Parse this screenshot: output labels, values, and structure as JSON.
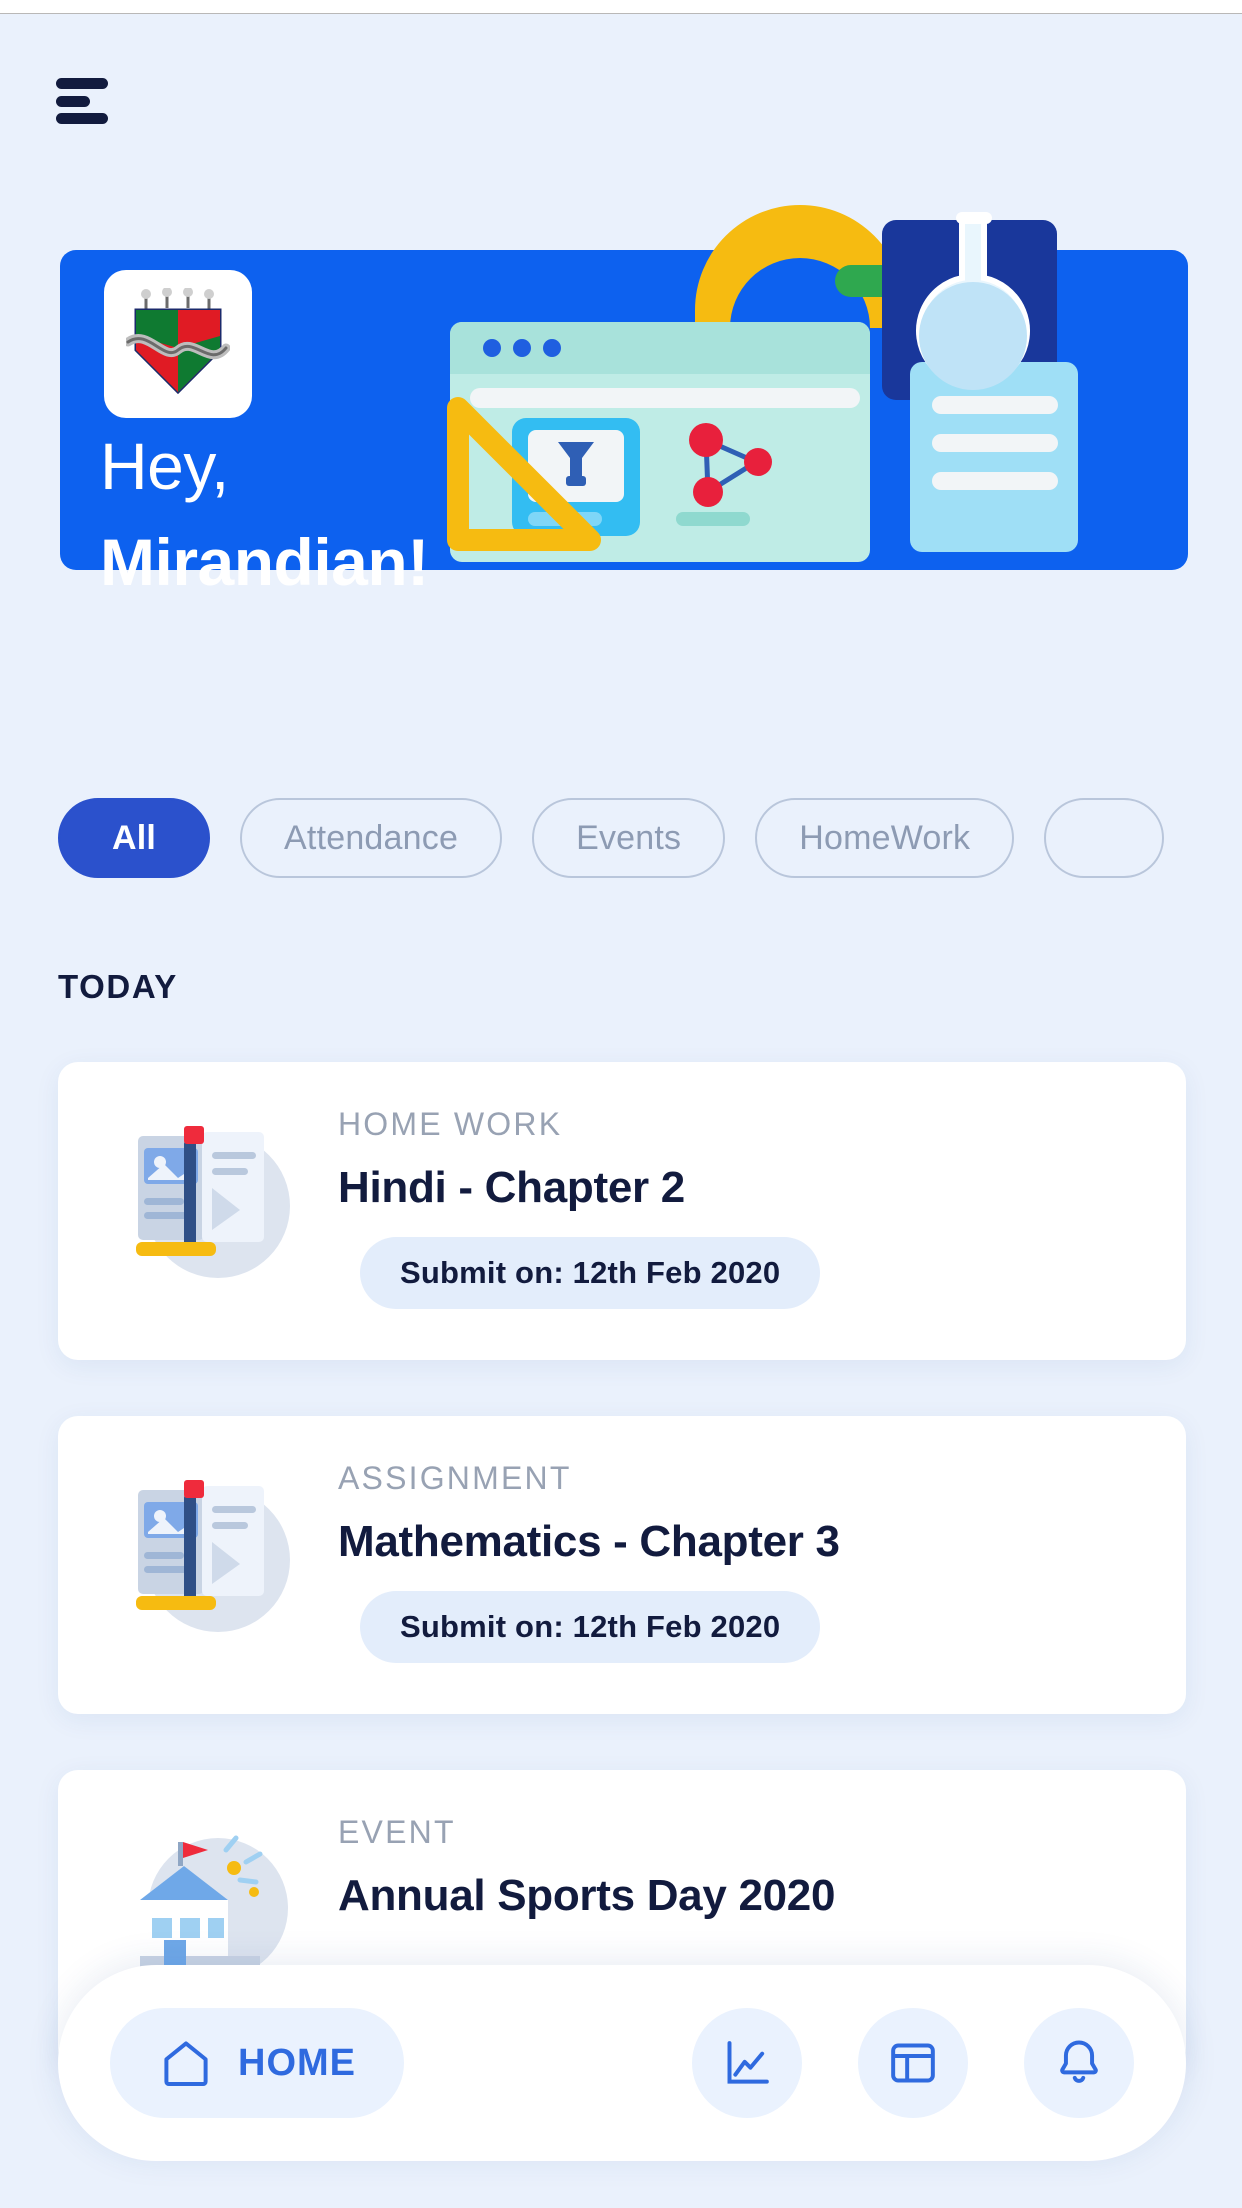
{
  "app": {
    "menu_icon": "hamburger-menu-icon",
    "logo_icon": "school-crest-logo"
  },
  "hero": {
    "greeting_line1": "Hey,",
    "greeting_line2": "Mirandian!",
    "accent_color": "#0d61ef",
    "illustration": "study-desk-illustration"
  },
  "filters": {
    "chips": [
      {
        "label": "All",
        "active": true
      },
      {
        "label": "Attendance",
        "active": false
      },
      {
        "label": "Events",
        "active": false
      },
      {
        "label": "HomeWork",
        "active": false
      },
      {
        "label": "",
        "active": false
      }
    ]
  },
  "feed": {
    "section_title": "TODAY",
    "items": [
      {
        "kicker": "HOME WORK",
        "title": "Hindi - Chapter 2",
        "due": "Submit on: 12th Feb 2020",
        "thumb": "homework-book-icon"
      },
      {
        "kicker": "ASSIGNMENT",
        "title": "Mathematics - Chapter 3",
        "due": "Submit on: 12th Feb 2020",
        "thumb": "assignment-book-icon"
      },
      {
        "kicker": "EVENT",
        "title": "Annual Sports Day 2020",
        "due": "",
        "thumb": "event-school-icon"
      }
    ]
  },
  "bottom_nav": {
    "home_label": "HOME",
    "items": [
      {
        "name": "home",
        "icon": "house-icon",
        "label": "HOME",
        "active": true
      },
      {
        "name": "reports",
        "icon": "line-chart-icon",
        "label": "",
        "active": false
      },
      {
        "name": "dashboard",
        "icon": "layout-panel-icon",
        "label": "",
        "active": false
      },
      {
        "name": "notifications",
        "icon": "bell-icon",
        "label": "",
        "active": false
      }
    ]
  },
  "colors": {
    "page_bg": "#eaf1fc",
    "brand_blue": "#0d61ef",
    "chip_active": "#2b51cc",
    "navy_text": "#121b3e",
    "muted_text": "#98a2b3",
    "pill_bg": "#e3edfb",
    "yellow": "#f5b800",
    "mint": "#bdeae3",
    "red": "#e8203c"
  }
}
